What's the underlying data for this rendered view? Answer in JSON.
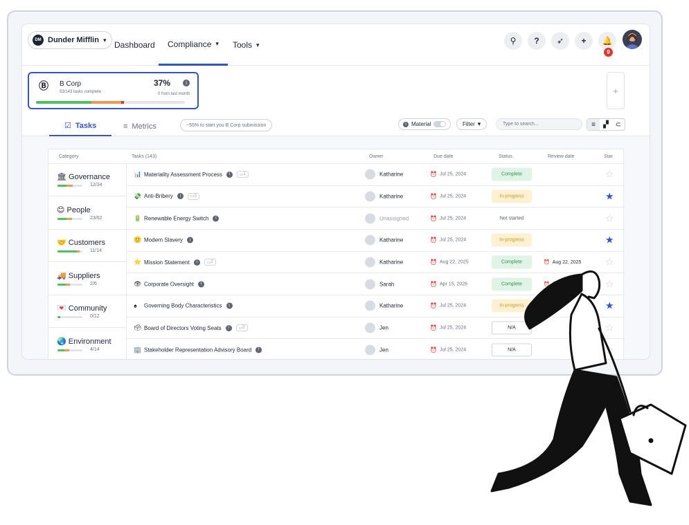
{
  "nav": {
    "org": "Dunder Mifflin",
    "links": [
      "Dashboard",
      "Compliance",
      "Tools"
    ],
    "notification_count": "9"
  },
  "bcorp": {
    "name": "B Corp",
    "subtitle": "53/143 tasks complete",
    "percent": "37%",
    "delta": "0 from last month",
    "progress": {
      "complete": 0.37,
      "in_progress": 0.2,
      "flag": 0.02
    }
  },
  "tabs": {
    "tasks": "Tasks",
    "metrics": "Metrics"
  },
  "hint": "~55% to start you B Corp submission",
  "filters": {
    "material": "Material",
    "filter": "Filter",
    "search_placeholder": "Type to search..."
  },
  "table": {
    "headers": {
      "category": "Category",
      "tasks": "Tasks (143)",
      "owner": "Owner",
      "due": "Due date",
      "status": "Status",
      "review": "Review date",
      "star": "Star"
    },
    "categories": [
      {
        "icon": "🏛",
        "name": "Governance",
        "count": "12/34",
        "green": 0.35,
        "orange": 0.25
      },
      {
        "icon": "😊",
        "name": "People",
        "count": "23/62",
        "green": 0.37,
        "orange": 0.2
      },
      {
        "icon": "🤝",
        "name": "Customers",
        "count": "11/14",
        "green": 0.78,
        "orange": 0.1
      },
      {
        "icon": "🚚",
        "name": "Suppliers",
        "count": "2/6",
        "green": 0.33,
        "orange": 0.17
      },
      {
        "icon": "💌",
        "name": "Community",
        "count": "0/12",
        "green": 0.1,
        "orange": 0
      },
      {
        "icon": "🌏",
        "name": "Environment",
        "count": "4/14",
        "green": 0.28,
        "orange": 0.2
      }
    ],
    "rows": [
      {
        "icon": "📊",
        "name": "Materiality Assessment Process",
        "comments": "1",
        "owner": "Katharine",
        "due": "Jul 25, 2024",
        "due_ok": false,
        "status": "Complete",
        "status_kind": "complete",
        "review": "",
        "starred": false
      },
      {
        "icon": "💸",
        "name": "Anti-Bribery",
        "comments": "0",
        "owner": "Katharine",
        "due": "Jul 25, 2024",
        "due_ok": false,
        "status": "In-progress",
        "status_kind": "progress",
        "review": "",
        "starred": true
      },
      {
        "icon": "🔋",
        "name": "Renewable Energy Switch",
        "comments": "",
        "owner": "Unassigned",
        "due": "Jul 25, 2024",
        "due_ok": false,
        "status": "Not started",
        "status_kind": "not",
        "review": "",
        "starred": false
      },
      {
        "icon": "🙂",
        "name": "Modern Slavery",
        "comments": "",
        "owner": "Katharine",
        "due": "Jul 25, 2024",
        "due_ok": false,
        "status": "In-progress",
        "status_kind": "progress",
        "review": "",
        "starred": true
      },
      {
        "icon": "⭐",
        "name": "Mission Statement",
        "comments": "2",
        "owner": "Katharine",
        "due": "Aug 22, 2025",
        "due_ok": true,
        "status": "Complete",
        "status_kind": "complete",
        "review": "Aug 22, 2025",
        "starred": false
      },
      {
        "icon": "👁",
        "name": "Corporate Oversight",
        "comments": "",
        "owner": "Sarah",
        "due": "Apr 15, 2026",
        "due_ok": true,
        "status": "Complete",
        "status_kind": "complete",
        "review": "Apr 15, 2026",
        "starred": false
      },
      {
        "icon": "♠",
        "name": "Governing Body Characteristics",
        "comments": "",
        "owner": "Katharine",
        "due": "Jul 25, 2024",
        "due_ok": false,
        "status": "In-progress",
        "status_kind": "progress",
        "review": "",
        "starred": true
      },
      {
        "icon": "🗳",
        "name": "Board of Directors Voting Seats",
        "comments": "0",
        "owner": "Jen",
        "due": "Jul 25, 2024",
        "due_ok": false,
        "status": "N/A",
        "status_kind": "na",
        "review": "",
        "starred": false
      },
      {
        "icon": "🏢",
        "name": "Stakeholder Representation Advisory Board",
        "comments": "",
        "owner": "Jen",
        "due": "Jul 25, 2024",
        "due_ok": false,
        "status": "N/A",
        "status_kind": "na",
        "review": "",
        "starred": false
      }
    ]
  },
  "colors": {
    "accent": "#2f55d4",
    "green": "#4cc35c",
    "orange": "#f19a4d",
    "red": "#e2352b"
  }
}
